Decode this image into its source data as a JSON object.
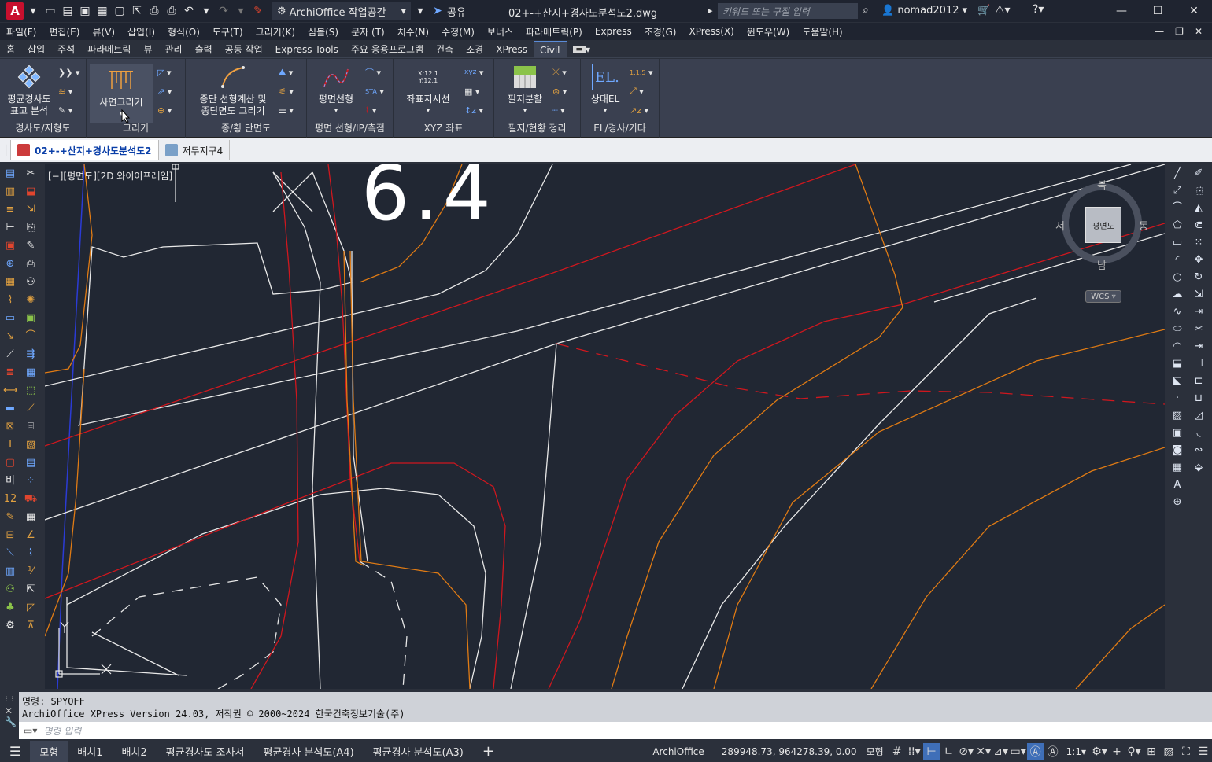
{
  "titlebar": {
    "workspace": "ArchiOffice 작업공간",
    "share": "공유",
    "file_title": "02+-+산지+경사도분석도2.dwg",
    "search_placeholder": "키워드 또는 구절 입력",
    "user": "nomad2012"
  },
  "menubar": [
    "파일(F)",
    "편집(E)",
    "뷰(V)",
    "삽입(I)",
    "형식(O)",
    "도구(T)",
    "그리기(K)",
    "심볼(S)",
    "문자 (T)",
    "치수(N)",
    "수정(M)",
    "보너스",
    "파라메트릭(P)",
    "Express",
    "조경(G)",
    "XPress(X)",
    "윈도우(W)",
    "도움말(H)"
  ],
  "ribbon_tabs": [
    "홈",
    "삽입",
    "주석",
    "파라메트릭",
    "뷰",
    "관리",
    "출력",
    "공동 작업",
    "Express Tools",
    "주요 응용프로그램",
    "건축",
    "조경",
    "XPress",
    "Civil"
  ],
  "ribbon_active_tab": "Civil",
  "ribbon": {
    "panels": [
      {
        "label": "경사도/지형도",
        "big": "평균경사도\n표고 분석"
      },
      {
        "label": "그리기",
        "big": "사면그리기"
      },
      {
        "label": "종/횡 단면도",
        "big": "종단 선형계산 및\n종단면도 그리기"
      },
      {
        "label": "평면 선형/IP/측점",
        "big": "평면선형"
      },
      {
        "label": "XYZ 좌표",
        "big": "좌표지시선"
      },
      {
        "label": "필지/현황 정리",
        "big": "필지분할"
      },
      {
        "label": "EL/경사/기타",
        "big": "상대EL"
      }
    ],
    "small_labels": {
      "sta": "STA",
      "el": "EL.",
      "xy1": "X:12.1",
      "xy2": "Y:12.1",
      "ratio": "1:1.5"
    }
  },
  "doc_tabs": [
    "02+-+산지+경사도분석도2",
    "저두지구4"
  ],
  "viewport": {
    "label": "[−][평면도][2D 와이어프레임]",
    "big_text": "6.4",
    "viewcube": {
      "top": "북",
      "bottom": "남",
      "left": "서",
      "right": "동",
      "face": "평면도",
      "wcs": "WCS"
    }
  },
  "command": {
    "history": [
      "명령: SPYOFF",
      "ArchiOffice XPress Version 24.03, 저작권 © 2000~2024 한국건축정보기술(주)"
    ],
    "placeholder": "명령 입력"
  },
  "statusbar": {
    "layout_tabs": [
      "모형",
      "배치1",
      "배치2",
      "평균경사도 조사서",
      "평균경사 분석도(A4)",
      "평균경사 분석도(A3)"
    ],
    "active_layout": "모형",
    "app": "ArchiOffice",
    "coords": "289948.73, 964278.39, 0.00",
    "space": "모형",
    "scale": "1:1"
  },
  "colors": {
    "red": "#d0171e",
    "orange": "#e07b14",
    "white": "#e8e8e8",
    "blue": "#2b3bd6",
    "canvas": "#212733"
  }
}
